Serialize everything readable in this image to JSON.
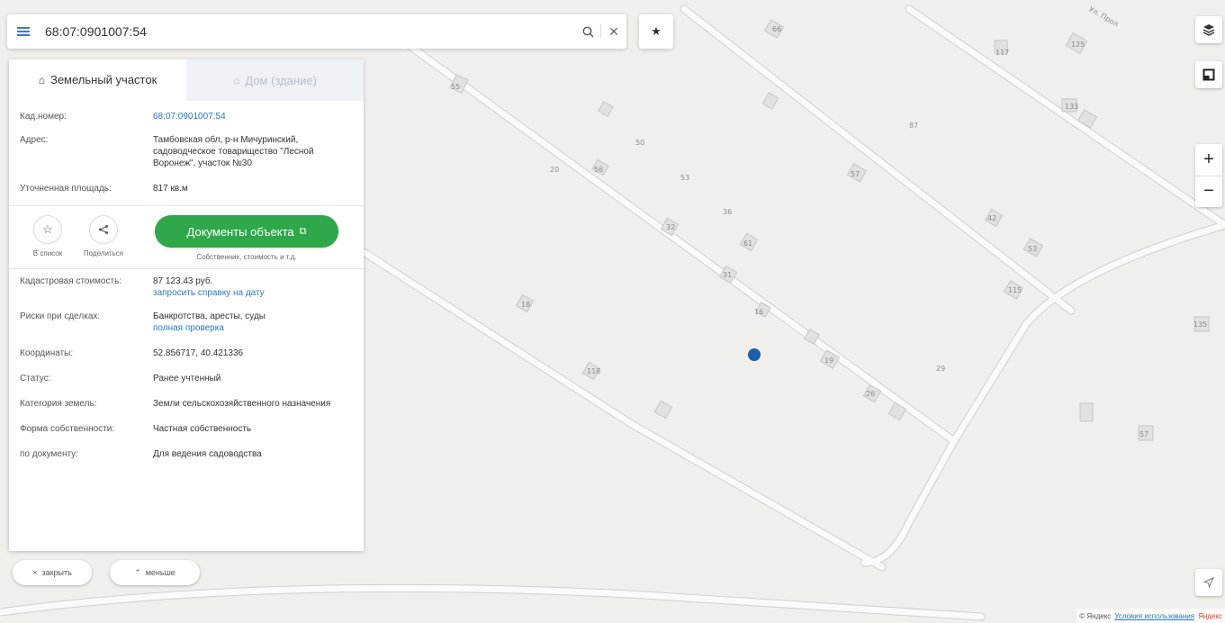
{
  "search": {
    "value": "68:07:0901007:54"
  },
  "tabs": [
    {
      "label": "Земельный участок",
      "active": true,
      "icon": "land-icon"
    },
    {
      "label": "Дом (здание)",
      "active": false,
      "icon": "house-icon"
    }
  ],
  "info_top": [
    {
      "key": "Кад.номер:",
      "value": "68:07:0901007:54",
      "is_link": true
    },
    {
      "key": "Адрес:",
      "value": "Тамбовская обл, р-н Мичуринский, садоводческое товарищество \"Лесной Воронеж\", участок №30"
    },
    {
      "key": "Уточненная площадь:",
      "value": "817 кв.м"
    }
  ],
  "actions": {
    "favorite_label": "В список",
    "share_label": "Поделиться",
    "documents_label": "Документы объекта",
    "documents_sub": "Собственник, стоимость и т.д."
  },
  "info_bottom": [
    {
      "key": "Кадастровая стоимость:",
      "value": "87 123.43 руб.",
      "link": "запросить справку на дату"
    },
    {
      "key": "Риски при сделках:",
      "value": "Банкротства, аресты, суды",
      "link": "полная проверка"
    },
    {
      "key": "Координаты:",
      "value": "52.856717, 40.421336"
    },
    {
      "key": "Статус:",
      "value": "Ранее учтенный"
    },
    {
      "key": "Категория земель:",
      "value": "Земли сельскохозяйственного назначения"
    },
    {
      "key": "Форма собственности:",
      "value": "Частная собственность"
    },
    {
      "key": "по документу:",
      "value": "Для ведения садоводства"
    }
  ],
  "bottom_buttons": {
    "close_label": "закрыть",
    "less_label": "меньше"
  },
  "map_labels": [
    "Ул. Прол",
    "117",
    "125",
    "133",
    "87",
    "66",
    "55",
    "50",
    "53",
    "56",
    "57",
    "61",
    "20",
    "36",
    "32",
    "18",
    "19",
    "16",
    "26",
    "29",
    "135",
    "57",
    "42",
    "31",
    "115",
    "53",
    "118"
  ],
  "attribution": {
    "copyright": "© Яндекс",
    "terms": "Условия использования",
    "brand": "Яндекс"
  },
  "colors": {
    "accent": "#2b78c2",
    "documents_button": "#2ea84a",
    "marker": "#1b5fab"
  }
}
